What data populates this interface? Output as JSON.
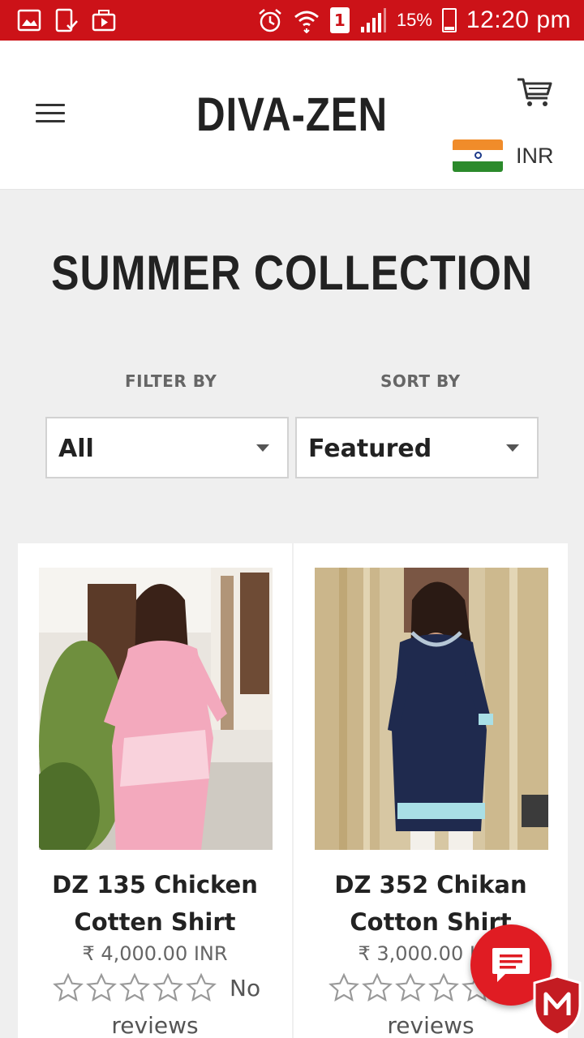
{
  "status_bar": {
    "battery": "15%",
    "time": "12:20 pm",
    "sim": "1",
    "icons": [
      "gallery-icon",
      "device-check-icon",
      "video-icon",
      "alarm-icon",
      "wifi-icon",
      "sim-icon",
      "signal-icon",
      "battery-icon"
    ]
  },
  "header": {
    "logo": "DIVA-ZEN",
    "currency": "INR"
  },
  "collection": {
    "title": "SUMMER COLLECTION",
    "filter_label": "FILTER BY",
    "filter_value": "All",
    "sort_label": "SORT BY",
    "sort_value": "Featured"
  },
  "products": [
    {
      "name": "DZ 135 Chicken Cotten Shirt",
      "price": "₹ 4,000.00 INR",
      "rating": 0,
      "reviews_line1": "No",
      "reviews_line2": "reviews",
      "image_colors": [
        "#f4b5c6",
        "#7a9a4e"
      ]
    },
    {
      "name": "DZ 352 Chikan Cotton Shirt",
      "price": "₹ 3,000.00 INR",
      "rating": 0,
      "reviews_line1": "No",
      "reviews_line2": "reviews",
      "image_colors": [
        "#1f2a4e",
        "#d9c9a2"
      ]
    }
  ],
  "colors": {
    "status_bar": "#cc1218",
    "chat_button": "#e01c23"
  }
}
